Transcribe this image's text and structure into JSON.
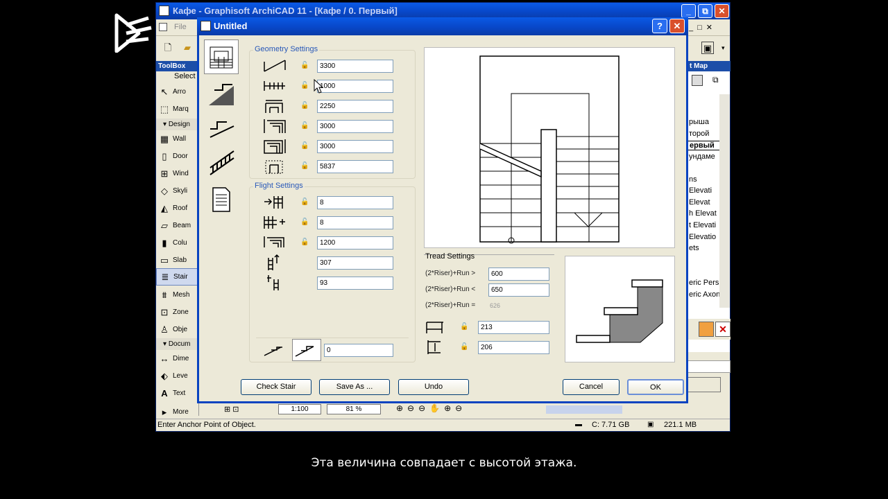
{
  "main_window": {
    "title": "Кафе - Graphisoft ArchiCAD 11 - [Кафе / 0. Первый]",
    "menu_file": "File",
    "controls": {
      "minimize": "_",
      "maximize": "□",
      "close": "✕",
      "restore": "⧉"
    }
  },
  "toolbox": {
    "title": "ToolBox",
    "select_label": "Select",
    "tools_top": [
      {
        "label": "Arro",
        "icon": "arrow-icon"
      },
      {
        "label": "Marq",
        "icon": "marquee-icon"
      }
    ],
    "design_label": "Design",
    "design_tools": [
      {
        "label": "Wall",
        "icon": "wall-icon"
      },
      {
        "label": "Door",
        "icon": "door-icon"
      },
      {
        "label": "Wind",
        "icon": "window-icon"
      },
      {
        "label": "Skyli",
        "icon": "skylight-icon"
      },
      {
        "label": "Roof",
        "icon": "roof-icon"
      },
      {
        "label": "Beam",
        "icon": "beam-icon"
      },
      {
        "label": "Colu",
        "icon": "column-icon"
      },
      {
        "label": "Slab",
        "icon": "slab-icon"
      },
      {
        "label": "Stair",
        "icon": "stair-icon"
      },
      {
        "label": "Mesh",
        "icon": "mesh-icon"
      },
      {
        "label": "Zone",
        "icon": "zone-icon"
      },
      {
        "label": "Obje",
        "icon": "object-icon"
      }
    ],
    "document_label": "Docum",
    "document_tools": [
      {
        "label": "Dime",
        "icon": "dimension-icon"
      },
      {
        "label": "Leve",
        "icon": "level-icon"
      },
      {
        "label": "Text",
        "icon": "text-icon"
      }
    ],
    "more_label": "More"
  },
  "navigator": {
    "title": "t Map",
    "items": [
      "рыша",
      "торой",
      "ервый",
      "ундаме",
      "ns",
      "Elevati",
      "Elevat",
      "h Elevat",
      "t Elevati",
      "Elevatio",
      "ets",
      "eric Pers",
      "eric Axon"
    ]
  },
  "nav_bar": {
    "scale": "1:100",
    "zoom": "81 %"
  },
  "status_bar": {
    "message": "Enter Anchor Point of Object.",
    "disk": "C: 7.71 GB",
    "memory": "221.1 MB"
  },
  "dialog": {
    "title": "Untitled",
    "help": "?",
    "close": "✕",
    "geometry_label": "Geometry Settings",
    "geometry_values": [
      "3300",
      "1000",
      "2250",
      "3000",
      "3000",
      "5837"
    ],
    "flight_label": "Flight Settings",
    "flight_values": [
      "8",
      "8",
      "1200",
      "307",
      "93"
    ],
    "bottom_value": "0",
    "tread": {
      "label": "Tread Settings",
      "row1_label": "(2*Riser)+Run >",
      "row1_value": "600",
      "row2_label": "(2*Riser)+Run <",
      "row2_value": "650",
      "row3_label": "(2*Riser)+Run =",
      "row3_value": "626",
      "tread_depth": "213",
      "riser_height": "206"
    },
    "buttons": {
      "check": "Check Stair",
      "save_as": "Save As ...",
      "undo": "Undo",
      "cancel": "Cancel",
      "ok": "OK"
    }
  },
  "subtitle": "Эта величина совпадает с высотой этажа."
}
